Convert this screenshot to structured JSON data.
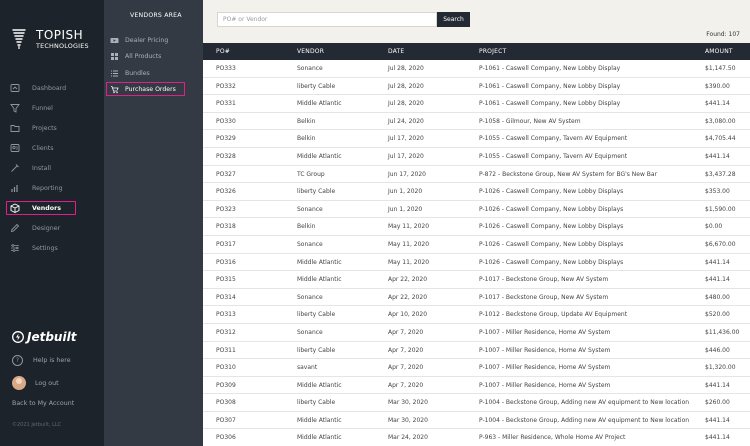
{
  "brand": {
    "logo_line1": "TOPISH",
    "logo_line2": "TECHNOLOGIES",
    "product": "Jetbuilt"
  },
  "nav": [
    {
      "label": "Dashboard",
      "icon": "dashboard-icon"
    },
    {
      "label": "Funnel",
      "icon": "funnel-icon"
    },
    {
      "label": "Projects",
      "icon": "folder-icon"
    },
    {
      "label": "Clients",
      "icon": "clients-icon"
    },
    {
      "label": "Install",
      "icon": "install-icon"
    },
    {
      "label": "Reporting",
      "icon": "bar-chart-icon"
    },
    {
      "label": "Vendors",
      "icon": "box-icon",
      "active": true
    },
    {
      "label": "Designer",
      "icon": "pencil-icon"
    },
    {
      "label": "Settings",
      "icon": "sliders-icon"
    }
  ],
  "footer": {
    "help": "Help is here",
    "logout": "Log out",
    "back": "Back to My Account",
    "copyright": "©2021 Jetbuilt, LLC"
  },
  "subnav": {
    "title": "VENDORS AREA",
    "items": [
      {
        "label": "Dealer Pricing",
        "icon": "video-icon"
      },
      {
        "label": "All Products",
        "icon": "grid-icon"
      },
      {
        "label": "Bundles",
        "icon": "list-icon"
      },
      {
        "label": "Purchase Orders",
        "icon": "purchase-order-icon",
        "active": true
      }
    ]
  },
  "search": {
    "placeholder": "PO# or Vendor",
    "button": "Search"
  },
  "found": "Found: 107",
  "columns": [
    "PO#",
    "VENDOR",
    "DATE",
    "PROJECT",
    "AMOUNT"
  ],
  "rows": [
    [
      "PO333",
      "Sonance",
      "Jul 28, 2020",
      "P-1061 - Caswell Company, New Lobby Display",
      "$1,147.50"
    ],
    [
      "PO332",
      "liberty Cable",
      "Jul 28, 2020",
      "P-1061 - Caswell Company, New Lobby Display",
      "$390.00"
    ],
    [
      "PO331",
      "Middle Atlantic",
      "Jul 28, 2020",
      "P-1061 - Caswell Company, New Lobby Display",
      "$441.14"
    ],
    [
      "PO330",
      "Belkin",
      "Jul 24, 2020",
      "P-1058 - Gilmour, New AV System",
      "$3,080.00"
    ],
    [
      "PO329",
      "Belkin",
      "Jul 17, 2020",
      "P-1055 - Caswell Company, Tavern AV Equipment",
      "$4,705.44"
    ],
    [
      "PO328",
      "Middle Atlantic",
      "Jul 17, 2020",
      "P-1055 - Caswell Company, Tavern AV Equipment",
      "$441.14"
    ],
    [
      "PO327",
      "TC Group",
      "Jun 17, 2020",
      "P-872 - Beckstone Group, New AV System for BG's New Bar",
      "$3,437.28"
    ],
    [
      "PO326",
      "liberty Cable",
      "Jun 1, 2020",
      "P-1026 - Caswell Company, New Lobby Displays",
      "$353.00"
    ],
    [
      "PO323",
      "Sonance",
      "Jun 1, 2020",
      "P-1026 - Caswell Company, New Lobby Displays",
      "$1,590.00"
    ],
    [
      "PO318",
      "Belkin",
      "May 11, 2020",
      "P-1026 - Caswell Company, New Lobby Displays",
      "$0.00"
    ],
    [
      "PO317",
      "Sonance",
      "May 11, 2020",
      "P-1026 - Caswell Company, New Lobby Displays",
      "$6,670.00"
    ],
    [
      "PO316",
      "Middle Atlantic",
      "May 11, 2020",
      "P-1026 - Caswell Company, New Lobby Displays",
      "$441.14"
    ],
    [
      "PO315",
      "Middle Atlantic",
      "Apr 22, 2020",
      "P-1017 - Beckstone Group, New AV System",
      "$441.14"
    ],
    [
      "PO314",
      "Sonance",
      "Apr 22, 2020",
      "P-1017 - Beckstone Group, New AV System",
      "$480.00"
    ],
    [
      "PO313",
      "liberty Cable",
      "Apr 10, 2020",
      "P-1012 - Beckstone Group, Update AV Equipment",
      "$520.00"
    ],
    [
      "PO312",
      "Sonance",
      "Apr 7, 2020",
      "P-1007 - Miller Residence, Home AV System",
      "$11,436.00"
    ],
    [
      "PO311",
      "liberty Cable",
      "Apr 7, 2020",
      "P-1007 - Miller Residence, Home AV System",
      "$446.00"
    ],
    [
      "PO310",
      "savant",
      "Apr 7, 2020",
      "P-1007 - Miller Residence, Home AV System",
      "$1,320.00"
    ],
    [
      "PO309",
      "Middle Atlantic",
      "Apr 7, 2020",
      "P-1007 - Miller Residence, Home AV System",
      "$441.14"
    ],
    [
      "PO308",
      "liberty Cable",
      "Mar 30, 2020",
      "P-1004 - Beckstone Group, Adding new AV equipment to New location",
      "$260.00"
    ],
    [
      "PO307",
      "Middle Atlantic",
      "Mar 30, 2020",
      "P-1004 - Beckstone Group, Adding new AV equipment to New location",
      "$441.14"
    ],
    [
      "PO306",
      "Middle Atlantic",
      "Mar 24, 2020",
      "P-963 - Miller Residence, Whole Home AV Project",
      "$441.14"
    ]
  ]
}
